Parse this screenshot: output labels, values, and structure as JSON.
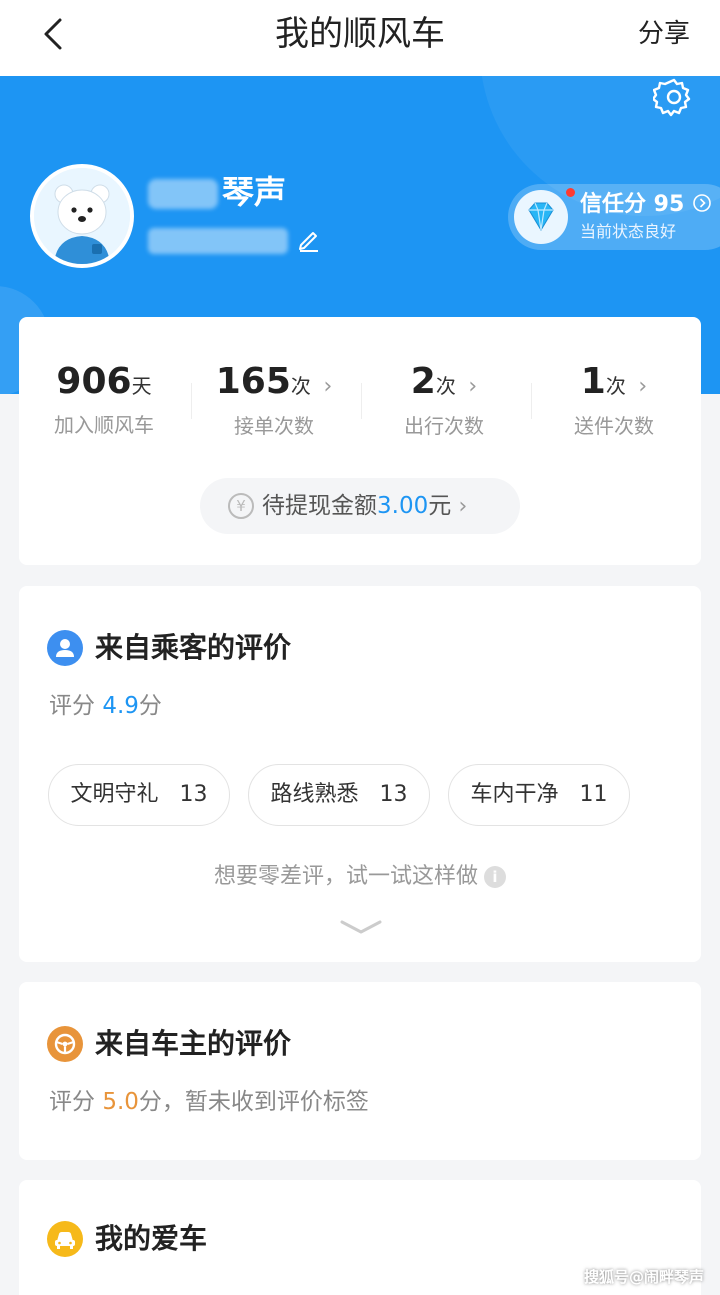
{
  "nav": {
    "title": "我的顺风车",
    "share_label": "分享"
  },
  "profile": {
    "name_visible": "琴声",
    "trust_label": "信任分 95",
    "trust_status": "当前状态良好"
  },
  "stats": [
    {
      "value": "906",
      "unit": "天",
      "label": "加入顺风车"
    },
    {
      "value": "165",
      "unit": "次",
      "label": "接单次数"
    },
    {
      "value": "2",
      "unit": "次",
      "label": "出行次数"
    },
    {
      "value": "1",
      "unit": "次",
      "label": "送件次数"
    }
  ],
  "withdraw": {
    "label": "待提现金额",
    "amount": "3.00",
    "unit": "元"
  },
  "passenger_review": {
    "title": "来自乘客的评价",
    "score_label": "评分",
    "score": "4.9",
    "score_unit": "分",
    "tags": [
      {
        "name": "文明守礼",
        "count": "13"
      },
      {
        "name": "路线熟悉",
        "count": "13"
      },
      {
        "name": "车内干净",
        "count": "11"
      }
    ],
    "tip": "想要零差评，试一试这样做"
  },
  "driver_review": {
    "title": "来自车主的评价",
    "score_label": "评分",
    "score": "5.0",
    "score_suffix": "分，暂未收到评价标签"
  },
  "my_car": {
    "title": "我的爱车"
  },
  "watermark": "搜狐号@闹畔琴声",
  "colors": {
    "brand_blue": "#1d95f3",
    "orange": "#e8943a",
    "yellow": "#f6b91a"
  }
}
